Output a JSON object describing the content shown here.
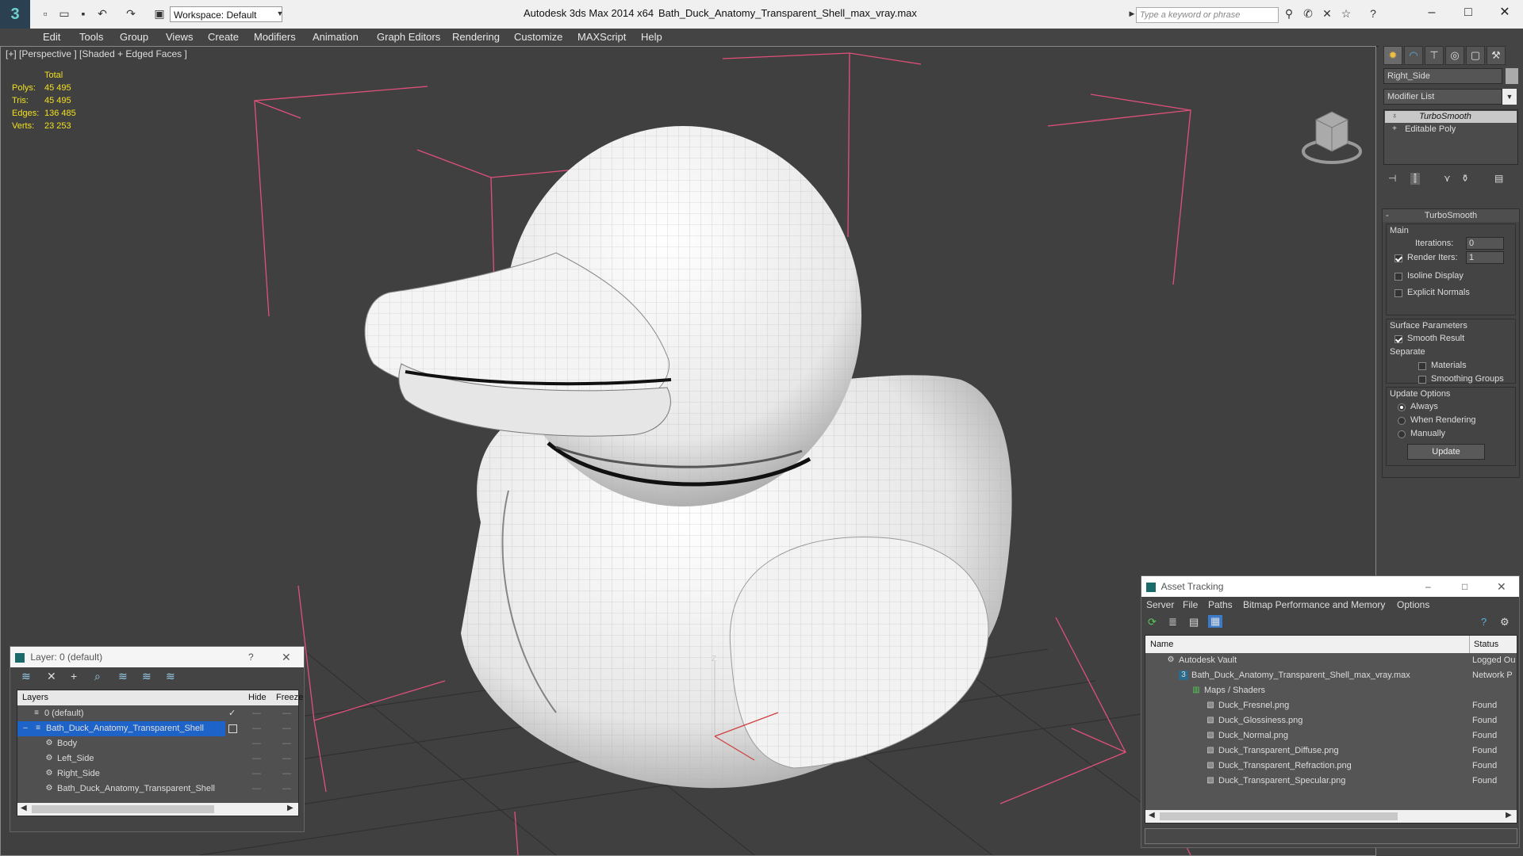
{
  "app": {
    "title": "Autodesk 3ds Max  2014 x64",
    "filename": "Bath_Duck_Anatomy_Transparent_Shell_max_vray.max",
    "workspace": "Workspace: Default",
    "search_placeholder": "Type a keyword or phrase"
  },
  "menu": [
    "Edit",
    "Tools",
    "Group",
    "Views",
    "Create",
    "Modifiers",
    "Animation",
    "Graph Editors",
    "Rendering",
    "Customize",
    "MAXScript",
    "Help"
  ],
  "viewport": {
    "label": "[+] [Perspective ] [Shaded + Edged Faces ]",
    "stats_header": "Total",
    "stats": [
      {
        "label": "Polys:",
        "value": "45 495"
      },
      {
        "label": "Tris:",
        "value": "45 495"
      },
      {
        "label": "Edges:",
        "value": "136 485"
      },
      {
        "label": "Verts:",
        "value": "23 253"
      }
    ],
    "axis_label": "Z"
  },
  "command_panel": {
    "object_name": "Right_Side",
    "modifier_list": "Modifier List",
    "stack": [
      "TurboSmooth",
      "Editable Poly"
    ],
    "rollout_title": "TurboSmooth",
    "main_label": "Main",
    "iterations_label": "Iterations:",
    "iterations_value": "0",
    "render_iters_label": "Render Iters:",
    "render_iters_value": "1",
    "isoline_label": "Isoline Display",
    "explicit_normals_label": "Explicit Normals",
    "surface_params_label": "Surface Parameters",
    "smooth_result_label": "Smooth Result",
    "separate_label": "Separate",
    "materials_label": "Materials",
    "smoothing_groups_label": "Smoothing Groups",
    "update_options_label": "Update Options",
    "always_label": "Always",
    "when_rendering_label": "When Rendering",
    "manually_label": "Manually",
    "update_button": "Update"
  },
  "layer_window": {
    "title": "Layer: 0 (default)",
    "help": "?",
    "columns": [
      "Layers",
      "Hide",
      "Freeze"
    ],
    "rows": [
      "0 (default)",
      "Bath_Duck_Anatomy_Transparent_Shell",
      "Body",
      "Left_Side",
      "Right_Side",
      "Bath_Duck_Anatomy_Transparent_Shell"
    ]
  },
  "asset_window": {
    "title": "Asset Tracking",
    "menu": [
      "Server",
      "File",
      "Paths",
      "Bitmap Performance and Memory",
      "Options"
    ],
    "columns": [
      "Name",
      "Status"
    ],
    "rows": [
      {
        "name": "Autodesk Vault",
        "status": "Logged Ou"
      },
      {
        "name": "Bath_Duck_Anatomy_Transparent_Shell_max_vray.max",
        "status": "Network P"
      },
      {
        "name": "Maps / Shaders",
        "status": ""
      },
      {
        "name": "Duck_Fresnel.png",
        "status": "Found"
      },
      {
        "name": "Duck_Glossiness.png",
        "status": "Found"
      },
      {
        "name": "Duck_Normal.png",
        "status": "Found"
      },
      {
        "name": "Duck_Transparent_Diffuse.png",
        "status": "Found"
      },
      {
        "name": "Duck_Transparent_Refraction.png",
        "status": "Found"
      },
      {
        "name": "Duck_Transparent_Specular.png",
        "status": "Found"
      }
    ]
  },
  "colors": {
    "selection": "#1e64c8",
    "stats_text": "#f0e020",
    "bounding_box": "#e0507a"
  }
}
